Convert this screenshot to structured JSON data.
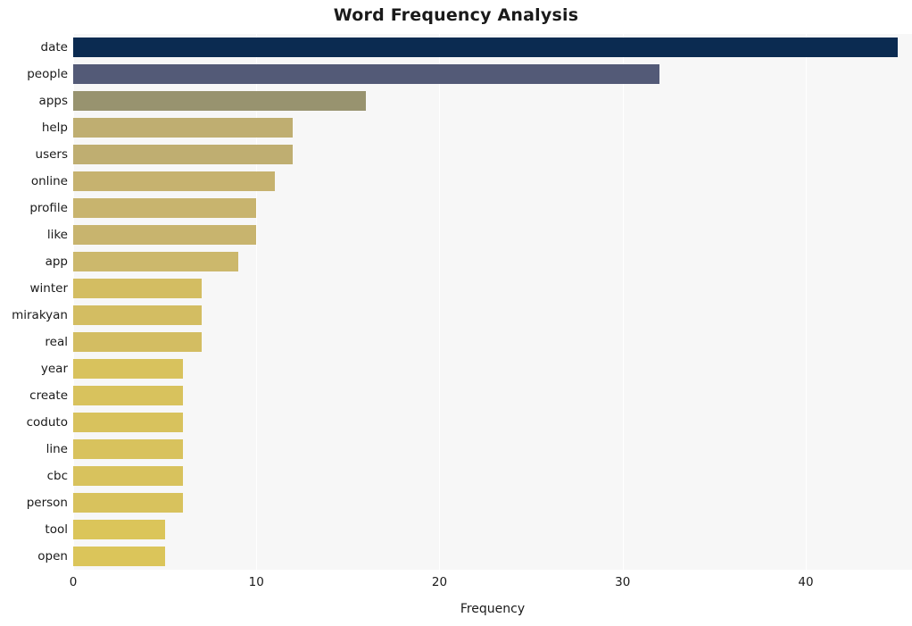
{
  "chart_data": {
    "type": "bar",
    "orientation": "horizontal",
    "title": "Word Frequency Analysis",
    "xlabel": "Frequency",
    "ylabel": "",
    "categories": [
      "date",
      "people",
      "apps",
      "help",
      "users",
      "online",
      "profile",
      "like",
      "app",
      "winter",
      "mirakyan",
      "real",
      "year",
      "create",
      "coduto",
      "line",
      "cbc",
      "person",
      "tool",
      "open"
    ],
    "values": [
      45,
      32,
      16,
      12,
      12,
      11,
      10,
      10,
      9,
      7,
      7,
      7,
      6,
      6,
      6,
      6,
      6,
      6,
      5,
      5
    ],
    "bar_colors": [
      "#0b2b51",
      "#535a77",
      "#98936f",
      "#bfae71",
      "#bfae71",
      "#c6b26f",
      "#c8b46e",
      "#c8b46e",
      "#ccb86c",
      "#d3bd62",
      "#d3bd62",
      "#d3bd62",
      "#d8c25d",
      "#d8c25d",
      "#d8c25d",
      "#d8c25d",
      "#d8c25d",
      "#d8c25d",
      "#dbc55a",
      "#dbc55a"
    ],
    "xlim": [
      0,
      45.8
    ],
    "xticks": [
      0,
      10,
      20,
      30,
      40
    ],
    "xtick_labels": [
      "0",
      "10",
      "20",
      "30",
      "40"
    ],
    "grid": true,
    "grid_color": "#ffffff",
    "plot_background": "#f7f7f7",
    "figure_background": "#ffffff",
    "legend": "none"
  }
}
